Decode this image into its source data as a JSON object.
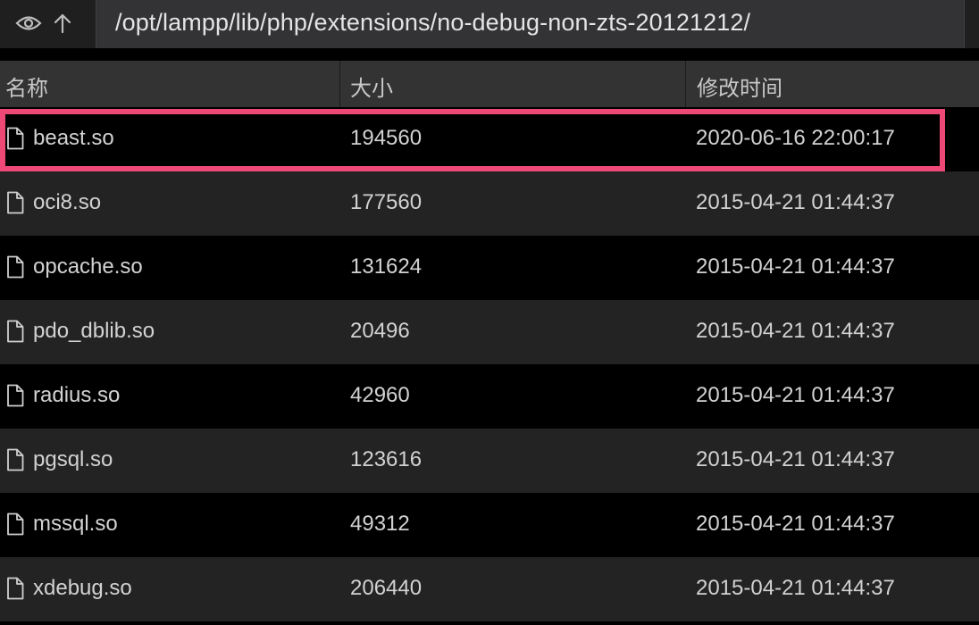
{
  "toolbar": {
    "eye_icon": "eye-icon",
    "up_icon": "arrow-up-icon",
    "path": "/opt/lampp/lib/php/extensions/no-debug-non-zts-20121212/"
  },
  "columns": {
    "name": "名称",
    "size": "大小",
    "modified": "修改时间"
  },
  "files": [
    {
      "name": "beast.so",
      "size": "194560",
      "modified": "2020-06-16 22:00:17",
      "highlighted": true
    },
    {
      "name": "oci8.so",
      "size": "177560",
      "modified": "2015-04-21 01:44:37"
    },
    {
      "name": "opcache.so",
      "size": "131624",
      "modified": "2015-04-21 01:44:37"
    },
    {
      "name": "pdo_dblib.so",
      "size": "20496",
      "modified": "2015-04-21 01:44:37"
    },
    {
      "name": "radius.so",
      "size": "42960",
      "modified": "2015-04-21 01:44:37"
    },
    {
      "name": "pgsql.so",
      "size": "123616",
      "modified": "2015-04-21 01:44:37"
    },
    {
      "name": "mssql.so",
      "size": "49312",
      "modified": "2015-04-21 01:44:37"
    },
    {
      "name": "xdebug.so",
      "size": "206440",
      "modified": "2015-04-21 01:44:37"
    }
  ],
  "colors": {
    "highlight": "#ee4877"
  }
}
